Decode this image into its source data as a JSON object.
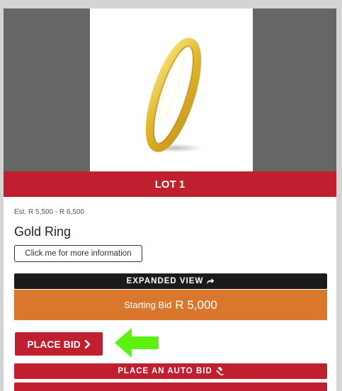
{
  "lot": {
    "label": "LOT 1",
    "estimate": "Est. R 5,500 - R 6,500",
    "title": "Gold Ring",
    "image_alt": "gold-ring-image"
  },
  "buttons": {
    "more_info": "Click me for more information",
    "expanded_view": "EXPANDED VIEW",
    "place_bid": "PLACE BID",
    "auto_bid": "PLACE AN AUTO BID"
  },
  "starting_bid": {
    "label": "Starting Bid",
    "amount": "R 5,000"
  },
  "icons": {
    "expanded_view": "share-arrow-icon",
    "place_bid": "chevron-right-icon",
    "auto_bid": "gavel-icon",
    "hint": "green-arrow-icon"
  },
  "colors": {
    "banner": "#c01f2f",
    "starting_bar": "#d9782d",
    "expanded_bar": "#1b1b1b",
    "hint_arrow": "#5ef00f",
    "image_backdrop": "#666666"
  }
}
